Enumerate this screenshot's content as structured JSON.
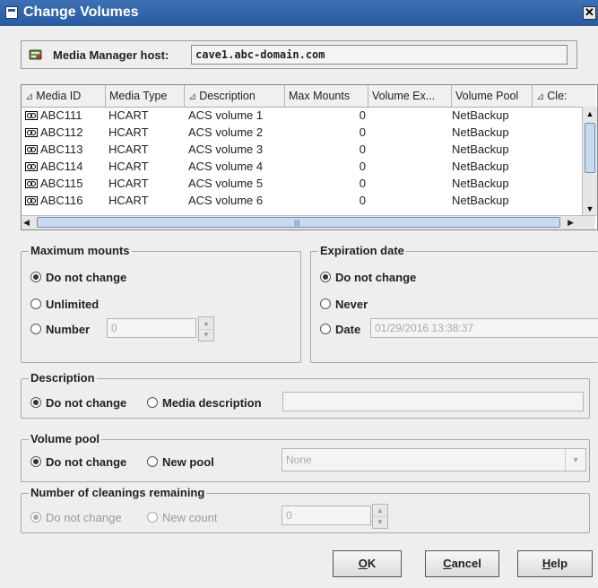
{
  "window": {
    "title": "Change Volumes",
    "close_glyph": "✕"
  },
  "host": {
    "label": "Media Manager host:",
    "value": "cave1.abc-domain.com",
    "icon": "server-icon"
  },
  "table": {
    "columns": [
      "Media ID",
      "Media Type",
      "Description",
      "Max Mounts",
      "Volume Ex...",
      "Volume Pool",
      "Cle:"
    ],
    "sorted_columns": [
      "Media ID",
      "Description",
      "Cle:"
    ],
    "rows": [
      {
        "media_id": "ABC111",
        "media_type": "HCART",
        "description": "ACS volume 1",
        "max_mounts": "0",
        "volume_exp": "",
        "volume_pool": "NetBackup"
      },
      {
        "media_id": "ABC112",
        "media_type": "HCART",
        "description": "ACS volume 2",
        "max_mounts": "0",
        "volume_exp": "",
        "volume_pool": "NetBackup"
      },
      {
        "media_id": "ABC113",
        "media_type": "HCART",
        "description": "ACS volume 3",
        "max_mounts": "0",
        "volume_exp": "",
        "volume_pool": "NetBackup"
      },
      {
        "media_id": "ABC114",
        "media_type": "HCART",
        "description": "ACS volume 4",
        "max_mounts": "0",
        "volume_exp": "",
        "volume_pool": "NetBackup"
      },
      {
        "media_id": "ABC115",
        "media_type": "HCART",
        "description": "ACS volume 5",
        "max_mounts": "0",
        "volume_exp": "",
        "volume_pool": "NetBackup"
      },
      {
        "media_id": "ABC116",
        "media_type": "HCART",
        "description": "ACS volume 6",
        "max_mounts": "0",
        "volume_exp": "",
        "volume_pool": "NetBackup"
      }
    ]
  },
  "maximum_mounts": {
    "title": "Maximum mounts",
    "options": [
      "Do not change",
      "Unlimited",
      "Number"
    ],
    "selected": "Do not change",
    "number_value": "0"
  },
  "expiration_date": {
    "title": "Expiration date",
    "options": [
      "Do not change",
      "Never",
      "Date"
    ],
    "selected": "Do not change",
    "date_value": "01/29/2016 13:38:37"
  },
  "description": {
    "title": "Description",
    "options": [
      "Do not change",
      "Media description"
    ],
    "selected": "Do not change",
    "value": ""
  },
  "volume_pool": {
    "title": "Volume pool",
    "options": [
      "Do not change",
      "New pool"
    ],
    "selected": "Do not change",
    "pool_value": "None"
  },
  "cleanings": {
    "title": "Number of cleanings remaining",
    "options": [
      "Do not change",
      "New count"
    ],
    "selected": "Do not change",
    "count_value": "0",
    "enabled": false
  },
  "buttons": {
    "ok": {
      "label": "OK",
      "mnemonic": "O"
    },
    "cancel": {
      "label": "Cancel",
      "mnemonic": "C"
    },
    "help": {
      "label": "Help",
      "mnemonic": "H"
    }
  }
}
